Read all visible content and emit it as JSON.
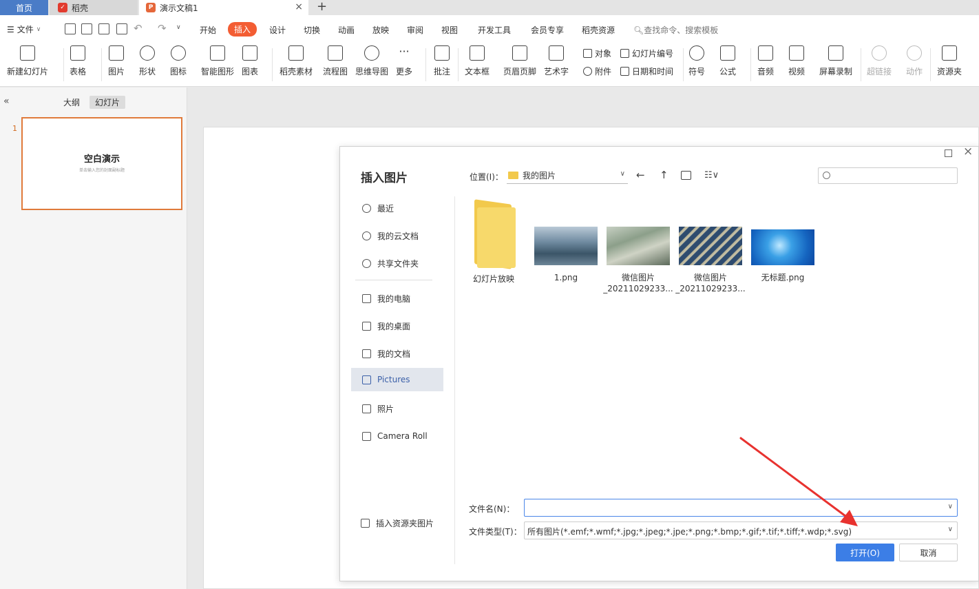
{
  "tabs": {
    "home": "首页",
    "daoke": "稻壳",
    "doc": "演示文稿1"
  },
  "menu": {
    "file": "文件",
    "items": [
      "开始",
      "插入",
      "设计",
      "切换",
      "动画",
      "放映",
      "审阅",
      "视图",
      "开发工具",
      "会员专享",
      "稻壳资源"
    ],
    "active": "插入",
    "search": "查找命令、搜索模板"
  },
  "ribbon": {
    "new_slide": "新建幻灯片",
    "table": "表格",
    "picture": "图片",
    "shape": "形状",
    "icon": "图标",
    "smart_shape": "智能图形",
    "chart": "图表",
    "daoke_material": "稻壳素材",
    "flowchart": "流程图",
    "mindmap": "思维导图",
    "more": "更多",
    "comment": "批注",
    "textbox": "文本框",
    "header_footer": "页眉页脚",
    "art_text": "艺术字",
    "object": "对象",
    "slide_number": "幻灯片编号",
    "attachment": "附件",
    "date_time": "日期和时间",
    "symbol": "符号",
    "formula": "公式",
    "audio": "音频",
    "video": "视频",
    "screen_record": "屏幕录制",
    "hyperlink": "超链接",
    "action": "动作",
    "resource_folder": "资源夹"
  },
  "left_pane": {
    "tab_outline": "大纲",
    "tab_slides": "幻灯片",
    "slide_number": "1",
    "thumb_title": "空白演示",
    "thumb_subtitle": "单击输入您的封面副标题"
  },
  "dialog": {
    "title": "插入图片",
    "location_label": "位置(I)：",
    "location_value": "我的图片",
    "nav": [
      "最近",
      "我的云文档",
      "共享文件夹",
      "我的电脑",
      "我的桌面",
      "我的文档",
      "Pictures",
      "照片",
      "Camera Roll"
    ],
    "nav_active": "Pictures",
    "nav_bottom": "插入资源夹图片",
    "files": [
      {
        "name_line1": "幻灯片放映",
        "name_line2": ""
      },
      {
        "name_line1": "1.png",
        "name_line2": ""
      },
      {
        "name_line1": "微信图片",
        "name_line2": "_20211029233..."
      },
      {
        "name_line1": "微信图片",
        "name_line2": "_20211029233..."
      },
      {
        "name_line1": "无标题.png",
        "name_line2": ""
      }
    ],
    "filename_label": "文件名(N)：",
    "filename_value": "",
    "filetype_label": "文件类型(T)：",
    "filetype_value": "所有图片(*.emf;*.wmf;*.jpg;*.jpeg;*.jpe;*.png;*.bmp;*.gif;*.tif;*.tiff;*.wdp;*.svg)",
    "open_button": "打开(O)",
    "cancel_button": "取消"
  },
  "colors": {
    "accent": "#f35d33",
    "primary_button": "#3c7ee6",
    "annotation_arrow": "#e8322f"
  }
}
